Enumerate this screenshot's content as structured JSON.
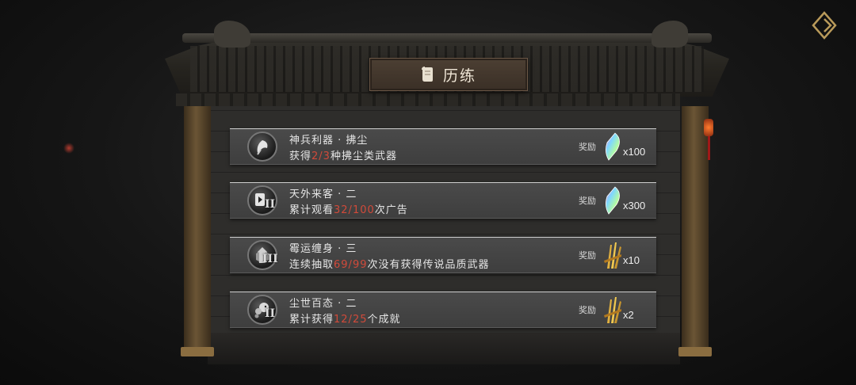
{
  "panel": {
    "title": "历练"
  },
  "tasks": [
    {
      "title": "神兵利器 · 拂尘",
      "desc_before": "获得",
      "progress": "2/3",
      "desc_after": "种拂尘类武器",
      "tier": "",
      "icon": "whisk-icon",
      "reward_label": "奖励",
      "reward_icon": "crystal-icon",
      "reward_qty": "x100"
    },
    {
      "title": "天外来客 · 二",
      "desc_before": "累计观看",
      "progress": "32/100",
      "desc_after": "次广告",
      "tier": "II",
      "icon": "video-icon",
      "reward_label": "奖励",
      "reward_icon": "crystal-icon",
      "reward_qty": "x300"
    },
    {
      "title": "霉运缠身 · 三",
      "desc_before": "连续抽取",
      "progress": "69/99",
      "desc_after": "次没有获得传说品质武器",
      "tier": "III",
      "icon": "shrine-icon",
      "reward_label": "奖励",
      "reward_icon": "golden-weapons-icon",
      "reward_qty": "x10"
    },
    {
      "title": "尘世百态 · 二",
      "desc_before": "累计获得",
      "progress": "12/25",
      "desc_after": "个成就",
      "tier": "II",
      "icon": "dragon-icon",
      "reward_label": "奖励",
      "reward_icon": "golden-weapons-icon",
      "reward_qty": "x2"
    }
  ],
  "colors": {
    "progress": "#d14a3a",
    "title_plaque": "#3a2f26",
    "card": "#444444"
  }
}
